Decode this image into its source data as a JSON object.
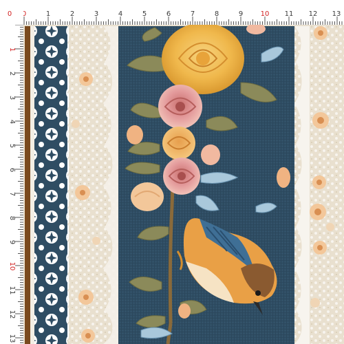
{
  "rulers": {
    "top": [
      "0",
      "1",
      "2",
      "3",
      "4",
      "5",
      "6",
      "7",
      "8",
      "9",
      "10",
      "11",
      "12",
      "13"
    ],
    "left": [
      "0",
      "1",
      "2",
      "3",
      "4",
      "5",
      "6",
      "7",
      "8",
      "9",
      "10",
      "11",
      "12",
      "13"
    ],
    "highlight": [
      "0",
      "10"
    ]
  },
  "colors": {
    "panel_blue": "#2f4d63",
    "lace_cream": "#e9e0cf",
    "lace_white": "#f7f4ee",
    "rose_yellow": "#f0b84c",
    "rose_pink": "#e39a9b",
    "rose_peach": "#f3c79a",
    "leaf_green": "#8b8a5a",
    "bird_orange": "#e9a046",
    "bird_blue": "#3f6f95",
    "ruler_red": "#d21f1f"
  },
  "icons": [
    "rose-icon",
    "leaf-icon",
    "bird-icon",
    "lace-border-icon",
    "ruler-icon"
  ]
}
